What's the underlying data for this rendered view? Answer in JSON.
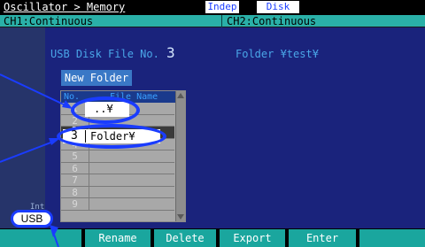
{
  "header": {
    "breadcrumb": "Oscillator > Memory",
    "tag_indep": "Indep",
    "tag_disk": "Disk"
  },
  "channels": {
    "ch1": "CH1:Continuous",
    "ch2": "CH2:Continuous"
  },
  "panel": {
    "file_label": "USB Disk File No.",
    "file_no": "3",
    "folder_path": "Folder ¥test¥",
    "new_folder_label": "New Folder"
  },
  "table": {
    "col_no": "No.",
    "col_name": "File Name",
    "rows": [
      {
        "no": "1",
        "name": ""
      },
      {
        "no": "2",
        "name": ""
      },
      {
        "no": "3",
        "name": ""
      },
      {
        "no": "4",
        "name": ""
      },
      {
        "no": "5",
        "name": ""
      },
      {
        "no": "6",
        "name": ""
      },
      {
        "no": "7",
        "name": ""
      },
      {
        "no": "8",
        "name": ""
      },
      {
        "no": "9",
        "name": ""
      }
    ]
  },
  "callouts": {
    "parent_dir": "..¥",
    "folder_no": "3",
    "folder_name": "Folder¥"
  },
  "left": {
    "partial_label": "Int",
    "usb_label": "USB"
  },
  "softkeys": {
    "k1": "",
    "k2": "Rename",
    "k3": "Delete",
    "k4": "Export",
    "k5": "Enter",
    "k6": ""
  },
  "colors": {
    "accent": "#1a3cff",
    "teal": "#1aa69e",
    "panel_blue": "#1a237c"
  }
}
